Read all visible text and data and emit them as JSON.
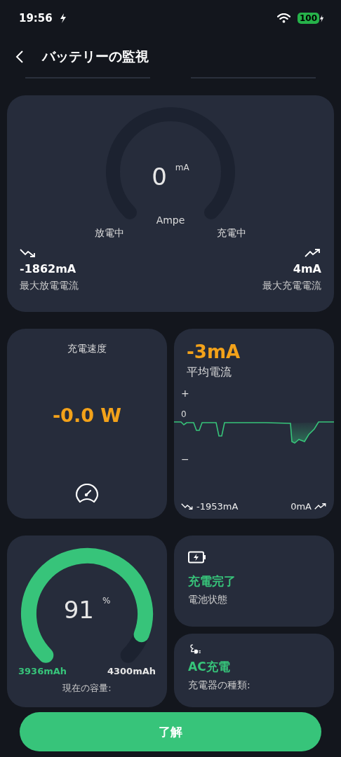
{
  "status_bar": {
    "time": "19:56",
    "battery": "100"
  },
  "header": {
    "title": "バッテリーの監視"
  },
  "current_card": {
    "value": "0",
    "unit": "mA",
    "label": "Ampe",
    "left_label": "放電中",
    "right_label": "充電中",
    "max_discharge": {
      "value": "-1862mA",
      "label": "最大放電電流"
    },
    "max_charge": {
      "value": "4mA",
      "label": "最大充電電流"
    }
  },
  "power_card": {
    "title": "充電速度",
    "value": "-0.0 W"
  },
  "average_card": {
    "value": "-3mA",
    "label": "平均電流",
    "plus": "+",
    "zero": "0",
    "minus": "−",
    "min": "-1953mA",
    "max": "0mA"
  },
  "capacity_card": {
    "value": "91",
    "unit": "%",
    "current": "3936mAh",
    "total": "4300mAh",
    "label": "現在の容量:"
  },
  "info_cards": [
    {
      "kind": "battery",
      "value": "充電完了",
      "label": "電池状態"
    },
    {
      "kind": "plug",
      "value": "AC充電",
      "label": "充電器の種類:"
    }
  ],
  "button": "了解"
}
